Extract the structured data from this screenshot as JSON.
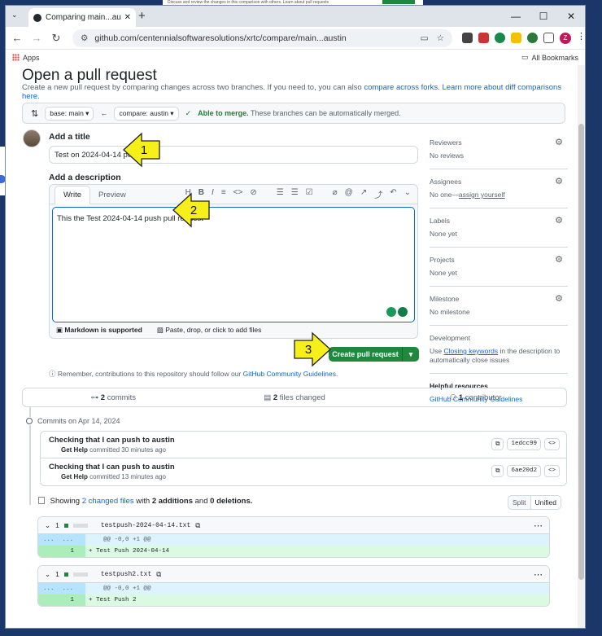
{
  "browser": {
    "tab_title": "Comparing main...austin · centenni",
    "url": "github.com/centennialsoftwaresolutions/xrtc/compare/main...austin",
    "bookmarks_apps": "Apps",
    "bookmarks_all": "All Bookmarks",
    "profile_letter": "Z",
    "bg_text": "Discuss and review the changes in this comparison with others. Learn about pull requests",
    "bg_button": "Create pull request"
  },
  "page": {
    "heading": "Open a pull request",
    "subtitle": "Create a new pull request by comparing changes across two branches. If you need to, you can also",
    "subtitle_link1": "compare across forks.",
    "subtitle_link2": "Learn more about diff comparisons here.",
    "base": "base: main",
    "compare": "compare: austin",
    "merge_ok": "Able to merge.",
    "merge_note": "These branches can be automatically merged.",
    "add_title_label": "Add a title",
    "title_value": "Test on 2024-04-14 push",
    "add_desc_label": "Add a description",
    "tab_write": "Write",
    "tab_preview": "Preview",
    "desc_value": "This the Test 2024-04-14 push pull request",
    "markdown_note": "Markdown is supported",
    "attach_note": "Paste, drop, or click to add files",
    "create_btn": "Create pull request",
    "remember_text": "Remember, contributions to this repository should follow our",
    "remember_link": "GitHub Community Guidelines."
  },
  "sidebar": {
    "reviewers": "Reviewers",
    "reviewers_val": "No reviews",
    "assignees": "Assignees",
    "assignees_val": "No one—",
    "assignees_link": "assign yourself",
    "labels": "Labels",
    "labels_val": "None yet",
    "projects": "Projects",
    "projects_val": "None yet",
    "milestone": "Milestone",
    "milestone_val": "No milestone",
    "development": "Development",
    "dev_pre": "Use",
    "dev_link": "Closing keywords",
    "dev_post": "in the description to automatically close issues",
    "help": "Helpful resources",
    "help_link": "GitHub Community Guidelines"
  },
  "stats": {
    "commits_n": "2",
    "commits": "commits",
    "files_n": "2",
    "files": "files changed",
    "contrib_n": "1",
    "contrib": "contributor"
  },
  "commits_on": "Commits on Apr 14, 2024",
  "commits": [
    {
      "msg": "Checking that I can push to austin",
      "author": "Get Help",
      "when": "committed 30 minutes ago",
      "sha": "1edcc99"
    },
    {
      "msg": "Checking that I can push to austin",
      "author": "Get Help",
      "when": "committed 13 minutes ago",
      "sha": "6ae20d2"
    }
  ],
  "showing": {
    "pre": "Showing",
    "link": "2 changed files",
    "mid": "with",
    "adds": "2 additions",
    "and": "and",
    "dels": "0 deletions."
  },
  "view_split": "Split",
  "view_unified": "Unified",
  "files": [
    {
      "n": "1",
      "name": "testpush-2024-04-14.txt",
      "hunk": "@@ -0,0 +1 @@",
      "line_no": "1",
      "line": "+ Test Push 2024-04-14"
    },
    {
      "n": "1",
      "name": "testpush2.txt",
      "hunk": "@@ -0,0 +1 @@",
      "line_no": "1",
      "line": "+ Test Push 2"
    }
  ],
  "hunk_dots": "...",
  "callouts": [
    "1",
    "2",
    "3"
  ],
  "icons": [
    "github-icon",
    "gear-icon",
    "check-icon",
    "git-compare-icon",
    "commit-icon",
    "copy-icon",
    "code-icon",
    "kebab-icon",
    "markdown-icon",
    "image-icon",
    "info-icon"
  ],
  "colors": {
    "accent": "#0969da",
    "success": "#1f883d",
    "callout": "#f7ef1a"
  }
}
